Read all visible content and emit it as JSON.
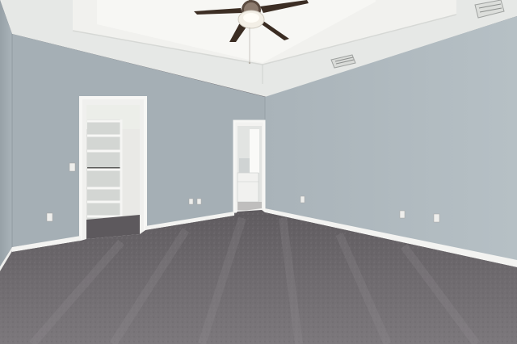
{
  "scene": {
    "kind": "empty-bedroom-interior",
    "elements": [
      "ceiling-fan-icon",
      "walk-in-closet-shelves",
      "bathroom-doorway",
      "carpet-floor",
      "air-vent-icon"
    ]
  },
  "colors": {
    "wall_left": "#a7b1b7",
    "wall_right": "#b2bcc1",
    "wall_far": "#a4aeb4",
    "ceiling": "#e9ebe9",
    "tray_ceiling": "#f4f4f1",
    "trim": "#f3f3f1",
    "carpet": "#6f6b6f",
    "carpet_light": "#8a868a",
    "fan_blade": "#3e2f25",
    "fan_light": "#f2eee4"
  }
}
